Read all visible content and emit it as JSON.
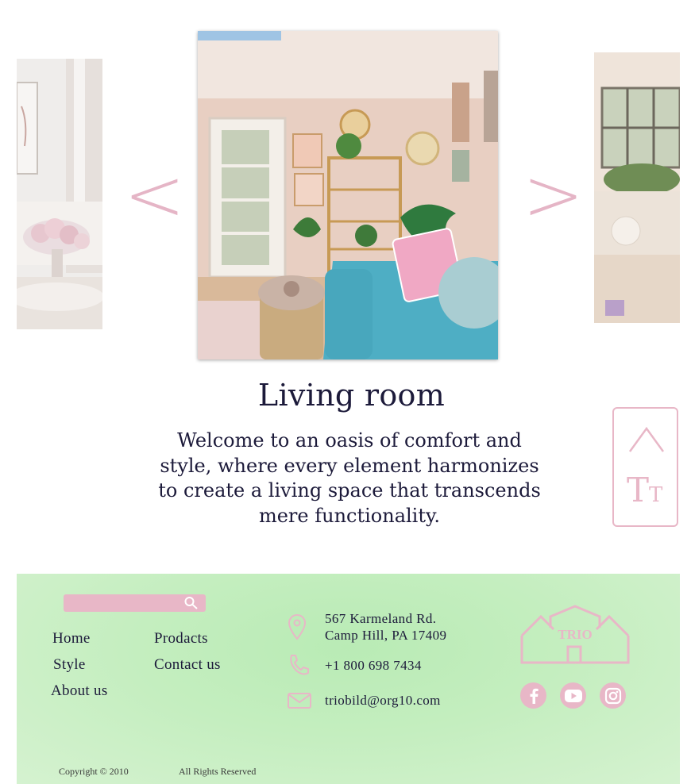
{
  "carousel": {
    "prev_arrow": "<",
    "next_arrow": ">",
    "title": "Living room",
    "description": "Welcome to an oasis of comfort and style, where every element harmonizes to create a living space that transcends mere functionality."
  },
  "side_widget": {
    "text_size_label": "T",
    "text_size_label_small": "T"
  },
  "footer": {
    "search": {
      "value": "",
      "placeholder": ""
    },
    "nav": {
      "home": "Home",
      "products": "Prodacts",
      "style": "Style",
      "contact": "Contact us",
      "about": "About us"
    },
    "address_line1": "567 Karmeland Rd.",
    "address_line2": "Camp Hill, PA 17409",
    "phone": "+1 800 698 7434",
    "email": "triobild@org10.com",
    "logo_text": "TRIO",
    "copyright": "Copyright © 2010",
    "rights": "All Rights Reserved"
  },
  "colors": {
    "accent_pink": "#e8b7c7",
    "footer_green": "#c4eebf",
    "text_navy": "#1c1a3a"
  },
  "icons": [
    "chevron-up-icon",
    "location-pin-icon",
    "phone-icon",
    "mail-icon",
    "search-icon",
    "facebook-icon",
    "youtube-icon",
    "instagram-icon"
  ]
}
